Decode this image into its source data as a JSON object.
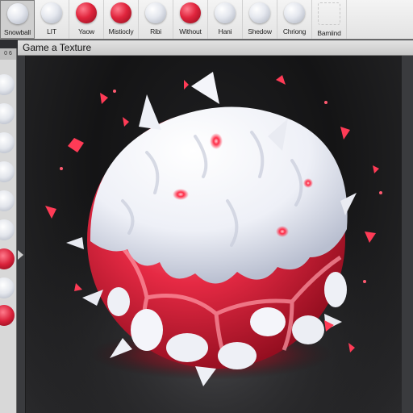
{
  "swatches": [
    {
      "label": "Snowball",
      "color": "white",
      "active": true
    },
    {
      "label": "LIT",
      "color": "white",
      "active": false
    },
    {
      "label": "Yaow",
      "color": "red",
      "active": false
    },
    {
      "label": "Mistiocly",
      "color": "red",
      "active": false
    },
    {
      "label": "Ribi",
      "color": "white",
      "active": false
    },
    {
      "label": "Without",
      "color": "red",
      "active": false
    },
    {
      "label": "Hani",
      "color": "white",
      "active": false
    },
    {
      "label": "Shedow",
      "color": "white",
      "active": false
    },
    {
      "label": "Chriong",
      "color": "white",
      "active": false
    },
    {
      "label": "Bamiind",
      "color": "empty",
      "active": false
    }
  ],
  "panel": {
    "title": "Game a Texture",
    "index": "0 6"
  },
  "colors": {
    "accent_red": "#e0253d",
    "snow": "#f2f3f8",
    "glow": "#ff3b56"
  }
}
